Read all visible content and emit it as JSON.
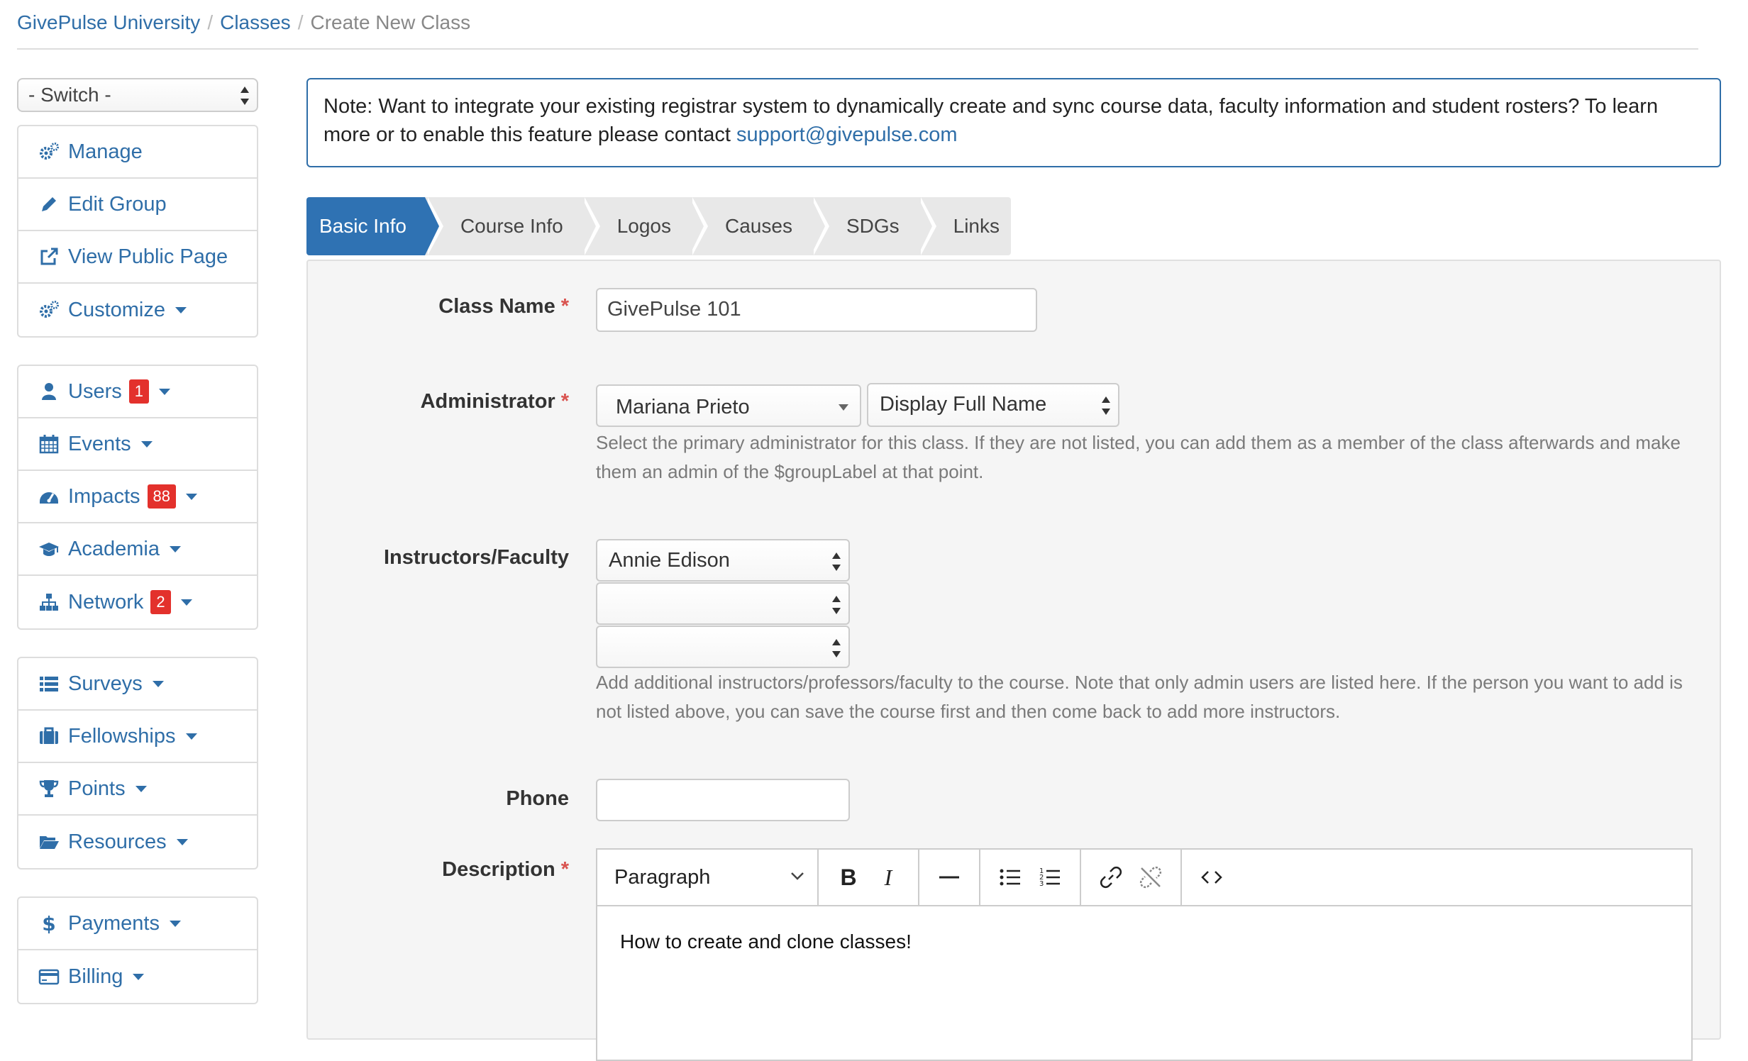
{
  "breadcrumb": {
    "items": [
      "GivePulse University",
      "Classes"
    ],
    "current": "Create New Class",
    "separator": "/"
  },
  "sidebar": {
    "switch": {
      "value": "- Switch -"
    },
    "group1": [
      {
        "label": "Manage",
        "icon": "gears-icon"
      },
      {
        "label": "Edit Group",
        "icon": "pencil-icon"
      },
      {
        "label": "View Public Page",
        "icon": "external-link-icon"
      },
      {
        "label": "Customize",
        "icon": "gears-icon"
      }
    ],
    "group2": [
      {
        "label": "Users",
        "icon": "user-icon",
        "badge": "1"
      },
      {
        "label": "Events",
        "icon": "calendar-icon"
      },
      {
        "label": "Impacts",
        "icon": "dashboard-icon",
        "badge": "88"
      },
      {
        "label": "Academia",
        "icon": "graduation-cap-icon"
      },
      {
        "label": "Network",
        "icon": "sitemap-icon",
        "badge": "2"
      }
    ],
    "group3": [
      {
        "label": "Surveys",
        "icon": "list-icon"
      },
      {
        "label": "Fellowships",
        "icon": "briefcase-icon"
      },
      {
        "label": "Points",
        "icon": "trophy-icon"
      },
      {
        "label": "Resources",
        "icon": "folder-open-icon"
      }
    ],
    "group4": [
      {
        "label": "Payments",
        "icon": "dollar-icon"
      },
      {
        "label": "Billing",
        "icon": "credit-card-icon"
      }
    ]
  },
  "note": {
    "text": "Note: Want to integrate your existing registrar system to dynamically create and sync course data, faculty information and student rosters? To learn more or to enable this feature please contact ",
    "link": "support@givepulse.com"
  },
  "tabs": [
    "Basic Info",
    "Course Info",
    "Logos",
    "Causes",
    "SDGs",
    "Links"
  ],
  "form": {
    "class_name": {
      "label": "Class Name",
      "value": "GivePulse 101"
    },
    "administrator": {
      "label": "Administrator",
      "value": "Mariana Prieto",
      "display": "Display Full Name",
      "help": "Select the primary administrator for this class. If they are not listed, you can add them as a member of the class afterwards and make them an admin of the $groupLabel at that point."
    },
    "instructors": {
      "label": "Instructors/Faculty",
      "values": [
        "Annie Edison",
        "",
        ""
      ],
      "help": "Add additional instructors/professors/faculty to the course. Note that only admin users are listed here. If the person you want to add is not listed above, you can save the course first and then come back to add more instructors."
    },
    "phone": {
      "label": "Phone",
      "value": ""
    },
    "description": {
      "label": "Description",
      "format": "Paragraph",
      "content": "How to create and clone classes!"
    },
    "required_mark": "*"
  },
  "colors": {
    "accent": "#2f72b3",
    "link": "#2f6ea8",
    "badge": "#e3312c",
    "required": "#d9534f"
  }
}
